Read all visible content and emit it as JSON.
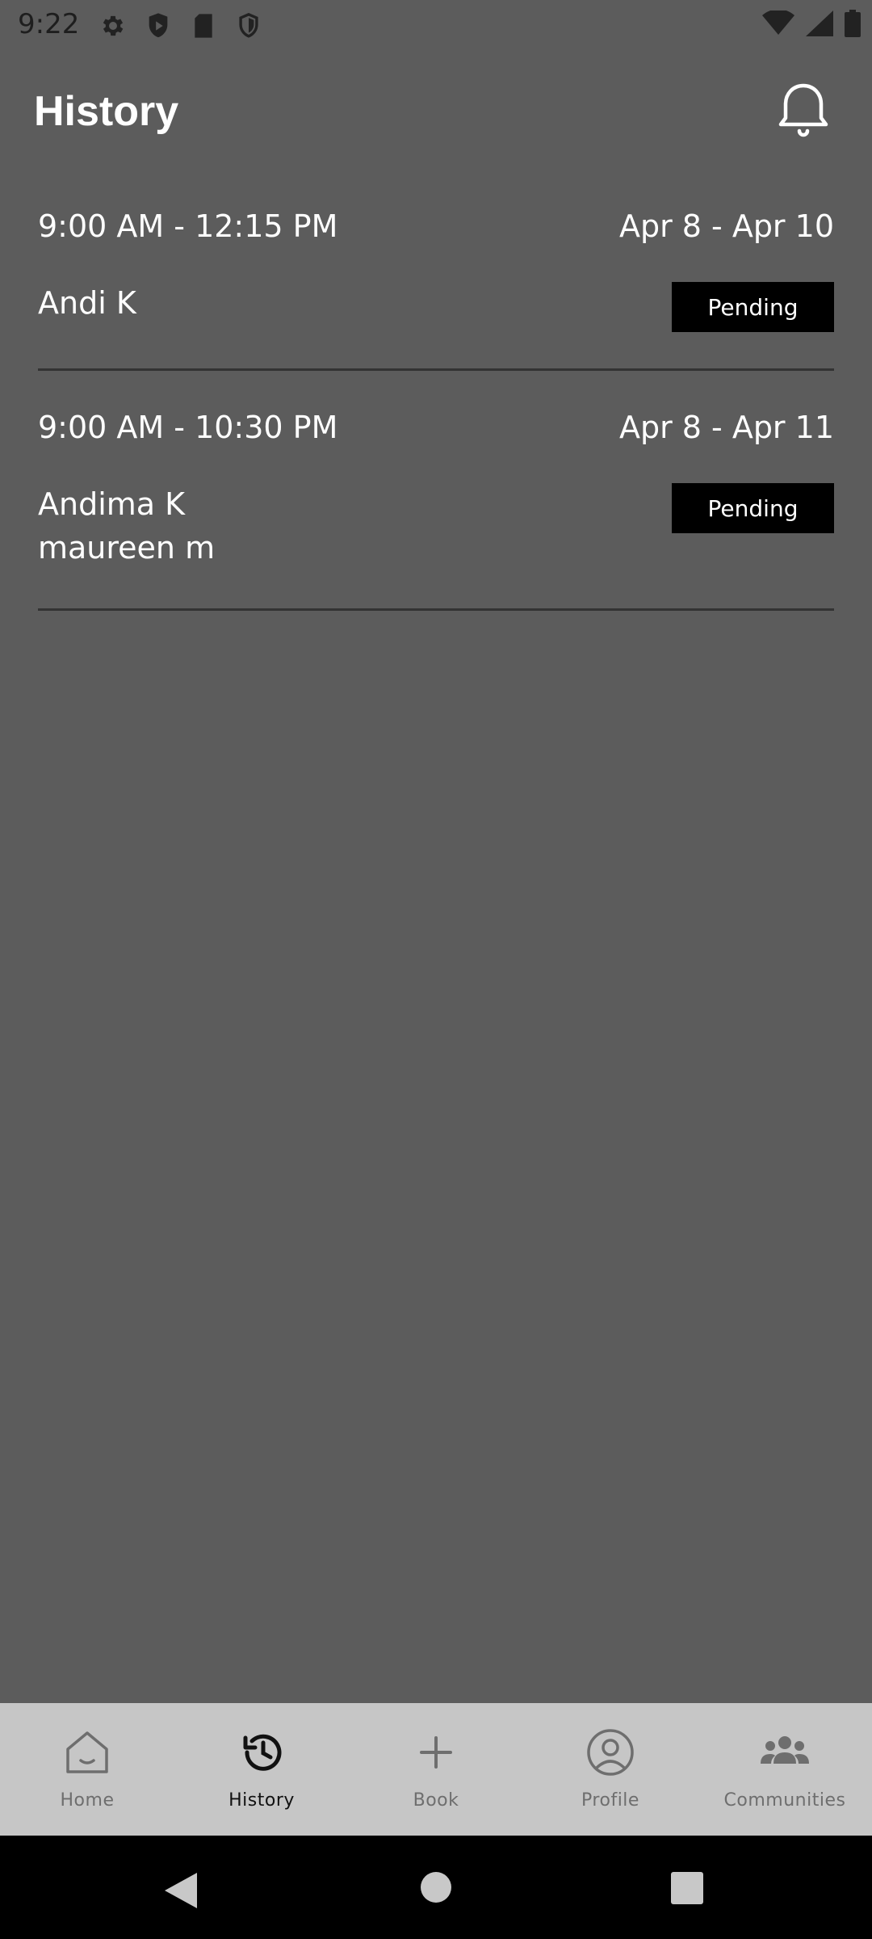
{
  "status_bar": {
    "time": "9:22",
    "left_icons": [
      "gear-icon",
      "shield-icon",
      "sd-card-icon",
      "shield-outline-icon"
    ],
    "right_icons": [
      "wifi-icon",
      "signal-icon",
      "battery-icon"
    ]
  },
  "header": {
    "title": "History",
    "bell_icon": "bell-icon"
  },
  "bookings": [
    {
      "time": "9:00 AM - 12:15 PM",
      "dates": "Apr 8 - Apr 10",
      "names": [
        "Andi K"
      ],
      "status": "Pending"
    },
    {
      "time": "9:00 AM - 10:30 PM",
      "dates": "Apr 8 - Apr 11",
      "names": [
        "Andima K",
        "maureen m"
      ],
      "status": "Pending"
    }
  ],
  "bottom_nav": {
    "items": [
      {
        "label": "Home",
        "icon": "home-icon",
        "active": false
      },
      {
        "label": "History",
        "icon": "history-icon",
        "active": true
      },
      {
        "label": "Book",
        "icon": "plus-icon",
        "active": false
      },
      {
        "label": "Profile",
        "icon": "profile-icon",
        "active": false
      },
      {
        "label": "Communities",
        "icon": "group-icon",
        "active": false
      }
    ]
  },
  "colors": {
    "background": "#5c5c5c",
    "badge": "#000000",
    "nav_background": "#c6c6c6",
    "nav_active": "#111111",
    "nav_inactive": "#6e6e6e"
  }
}
